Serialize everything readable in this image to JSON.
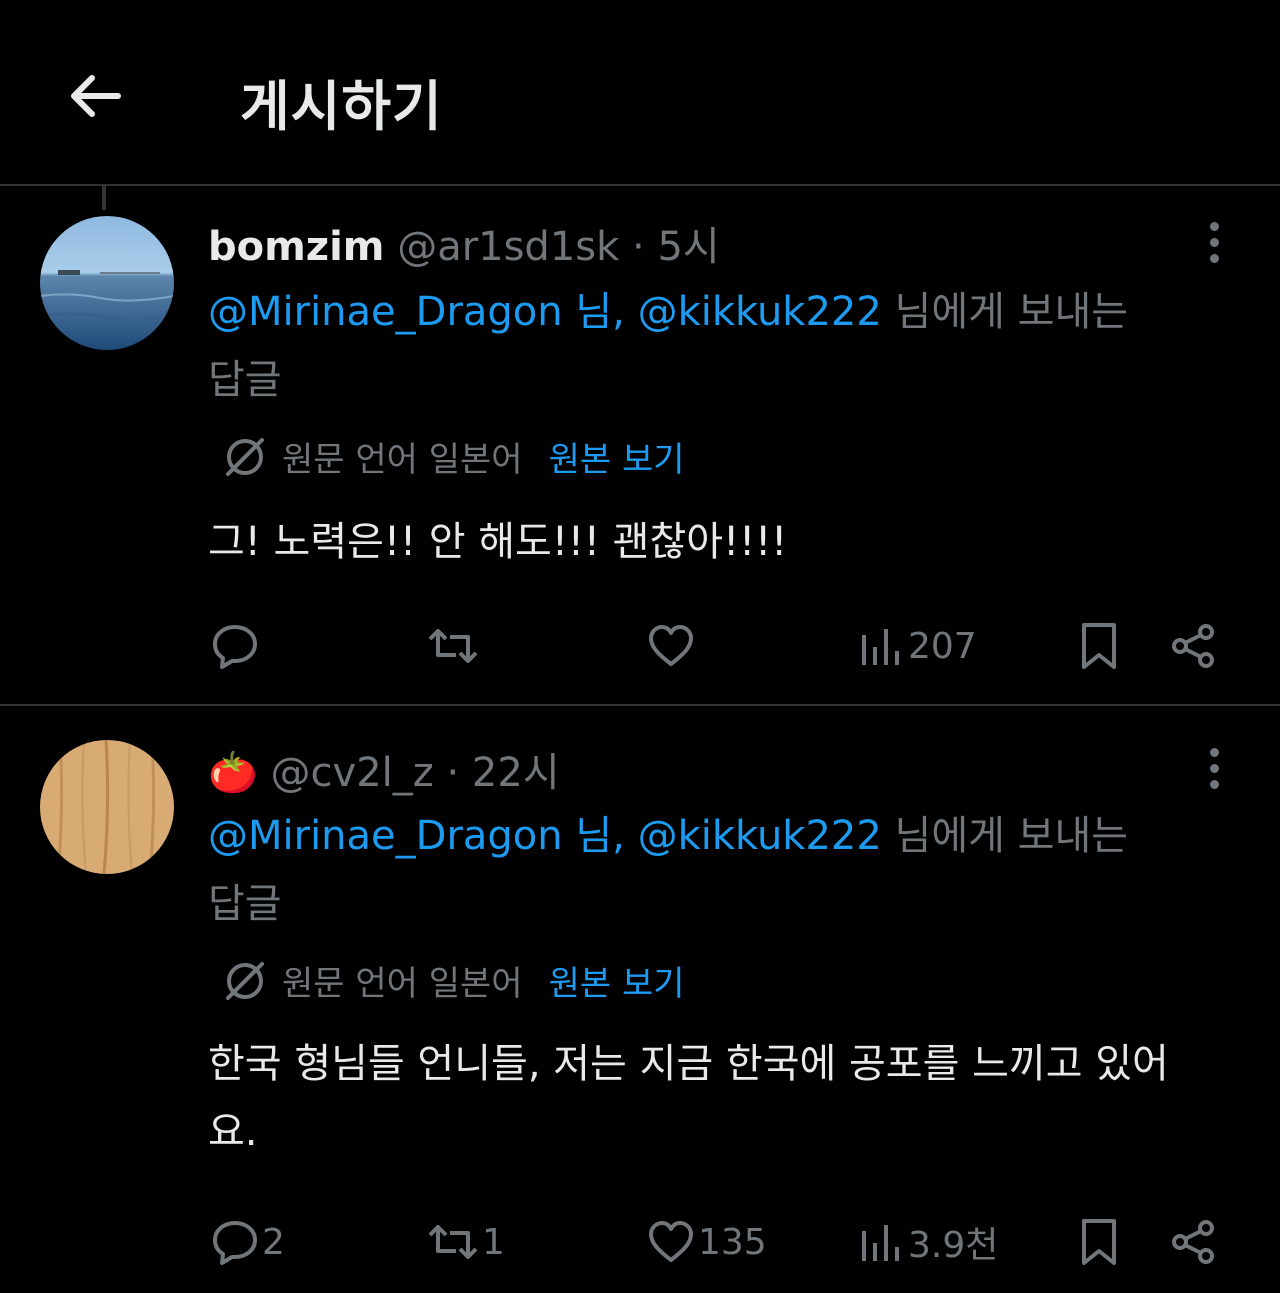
{
  "header": {
    "title": "게시하기"
  },
  "posts": [
    {
      "display_name": "bomzim",
      "handle": "@ar1sd1sk",
      "sep": " · ",
      "time": "5시",
      "reply_mentions": "@Mirinae_Dragon 님, @kikkuk222",
      "reply_suffix": " 님에게 보내는 답글",
      "translate_label": "원문 언어 일본어",
      "show_original": "원본 보기",
      "text": "그! 노력은!! 안 해도!!! 괜찮아!!!!",
      "stats": {
        "replies": "",
        "reposts": "",
        "likes": "",
        "views": "207"
      },
      "avatar": "sea-photo"
    },
    {
      "display_name": "🍅",
      "handle": "@cv2l_z",
      "sep": " · ",
      "time": "22시",
      "reply_mentions": "@Mirinae_Dragon 님, @kikkuk222",
      "reply_suffix": " 님에게 보내는 답글",
      "translate_label": "원문 언어 일본어",
      "show_original": "원본 보기",
      "text": "한국 형님들 언니들, 저는 지금 한국에 공포를 느끼고 있어요.",
      "stats": {
        "replies": "2",
        "reposts": "1",
        "likes": "135",
        "views": "3.9천"
      },
      "avatar": "wood-texture"
    }
  ],
  "icons": {
    "back": "arrow-left-icon",
    "more": "more-vertical-icon",
    "translate": "globe-slash-icon",
    "reply": "comment-icon",
    "repost": "repost-icon",
    "like": "heart-icon",
    "views": "bar-chart-icon",
    "bookmark": "bookmark-icon",
    "share": "share-icon"
  },
  "colors": {
    "background": "#000000",
    "text": "#e7e9ea",
    "muted": "#71767b",
    "link": "#1d9bf0",
    "divider": "#2f3336"
  }
}
